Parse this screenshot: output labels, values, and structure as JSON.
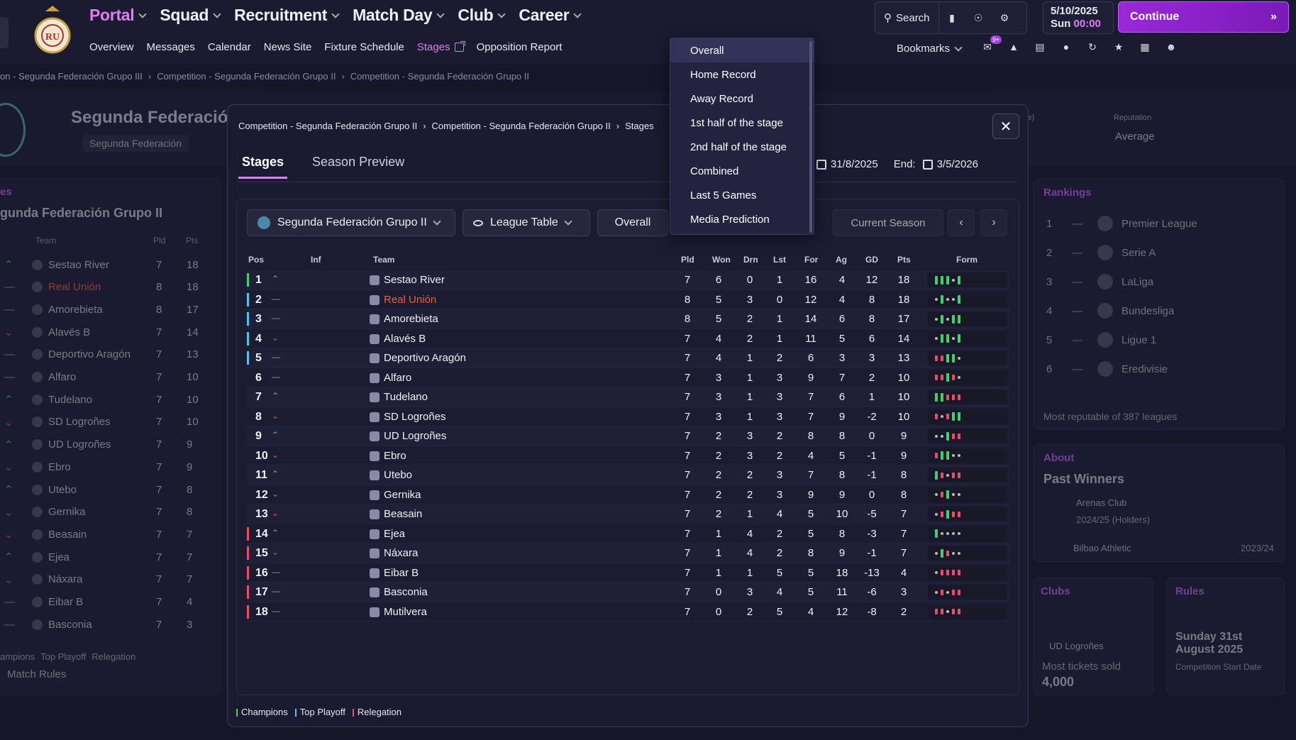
{
  "nav": {
    "main": [
      {
        "label": "Portal",
        "active": true
      },
      {
        "label": "Squad",
        "active": false
      },
      {
        "label": "Recruitment",
        "active": false
      },
      {
        "label": "Match Day",
        "active": false
      },
      {
        "label": "Club",
        "active": false
      },
      {
        "label": "Career",
        "active": false
      }
    ],
    "sub": [
      "Overview",
      "Messages",
      "Calendar",
      "News Site",
      "Fixture Schedule",
      "Stages",
      "Opposition Report"
    ],
    "sub_active": "Stages"
  },
  "toolbar": {
    "search_label": "Search",
    "bookmarks_label": "Bookmarks",
    "badge": "9+"
  },
  "date": {
    "date": "5/10/2025",
    "day": "Sun",
    "time": "00:00"
  },
  "continue_label": "Continue",
  "breadcrumb": [
    "on - Segunda Federación Grupo III",
    "Competition - Segunda Federación Grupo II",
    "Competition - Segunda Federación Grupo II"
  ],
  "background": {
    "comp_title": "Segunda Federación",
    "comp_sub": "Segunda Federación",
    "reputation_label": "Reputation",
    "reputation_value": "Average",
    "paren_text": "je)",
    "left_title": "gunda Federación Grupo II",
    "left_section": "es",
    "left_headers": [
      "Team",
      "Pld",
      "Pts"
    ],
    "left_rows": [
      {
        "team": "Sestao River",
        "pld": "7",
        "pts": "18"
      },
      {
        "team": "Real Unión",
        "pld": "8",
        "pts": "18"
      },
      {
        "team": "Amorebieta",
        "pld": "8",
        "pts": "17"
      },
      {
        "team": "Alavés B",
        "pld": "7",
        "pts": "14"
      },
      {
        "team": "Deportivo Aragón",
        "pld": "7",
        "pts": "13"
      },
      {
        "team": "Alfaro",
        "pld": "7",
        "pts": "10"
      },
      {
        "team": "Tudelano",
        "pld": "7",
        "pts": "10"
      },
      {
        "team": "SD Logroñes",
        "pld": "7",
        "pts": "10"
      },
      {
        "team": "UD Logroñes",
        "pld": "7",
        "pts": "9"
      },
      {
        "team": "Ebro",
        "pld": "7",
        "pts": "9"
      },
      {
        "team": "Utebo",
        "pld": "7",
        "pts": "8"
      },
      {
        "team": "Gernika",
        "pld": "7",
        "pts": "8"
      },
      {
        "team": "Beasain",
        "pld": "7",
        "pts": "7"
      },
      {
        "team": "Ejea",
        "pld": "7",
        "pts": "7"
      },
      {
        "team": "Náxara",
        "pld": "7",
        "pts": "7"
      },
      {
        "team": "Eibar B",
        "pld": "7",
        "pts": "4"
      },
      {
        "team": "Basconia",
        "pld": "7",
        "pts": "3"
      }
    ],
    "left_legend": [
      "ampions",
      "Top Playoff",
      "Relegation"
    ],
    "match_rules": "Match Rules",
    "rankings_title": "Rankings",
    "rankings": [
      {
        "pos": "1",
        "name": "Premier League"
      },
      {
        "pos": "2",
        "name": "Serie A"
      },
      {
        "pos": "3",
        "name": "LaLiga"
      },
      {
        "pos": "4",
        "name": "Bundesliga"
      },
      {
        "pos": "5",
        "name": "Ligue 1"
      },
      {
        "pos": "6",
        "name": "Eredivisie"
      }
    ],
    "rankings_note": "Most reputable of 387 leagues",
    "about_title": "About",
    "past_winners": "Past Winners",
    "winner1_club": "Arenas Club",
    "winner1_season": "2024/25 (Holders)",
    "winner2_club": "Bilbao Athletic",
    "winner2_season": "2023/24",
    "clubs_title": "Clubs",
    "clubs_club": "UD Logroñes",
    "clubs_stat_label": "Most tickets sold",
    "clubs_stat_value": "4,000",
    "rules_title": "Rules",
    "rules_date": "Sunday 31st August 2025",
    "rules_note": "Competition Start Date"
  },
  "modal": {
    "crumb": [
      "Competition - Segunda Federación Grupo II",
      "Competition - Segunda Federación Grupo II",
      "Stages"
    ],
    "tabs": [
      "Stages",
      "Season Preview"
    ],
    "start_date": "31/8/2025",
    "end_label": "End:",
    "end_date": "3/5/2026",
    "competition_select": "Segunda Federación Grupo II",
    "view_select": "League Table",
    "record_select": "Overall",
    "current_season": "Current Season",
    "headers": [
      "Pos",
      "Inf",
      "Team",
      "Pld",
      "Won",
      "Drn",
      "Lst",
      "For",
      "Ag",
      "GD",
      "Pts",
      "Form"
    ],
    "legend": [
      "Champions",
      "Top Playoff",
      "Relegation"
    ],
    "legend_colors": [
      "#3ed36a",
      "#4ac8e8",
      "#f04a6a"
    ]
  },
  "dropdown": {
    "items": [
      "Overall",
      "Home Record",
      "Away Record",
      "1st half of the stage",
      "2nd half of the stage",
      "Combined",
      "Last 5 Games",
      "Media Prediction"
    ],
    "selected": "Overall"
  },
  "table": [
    {
      "pos": "1",
      "move": "up",
      "team": "Sestao River",
      "pld": "7",
      "won": "6",
      "drn": "0",
      "lst": "1",
      "for": "16",
      "ag": "4",
      "gd": "12",
      "pts": "18",
      "zone": "champ",
      "form": "WWWDW"
    },
    {
      "pos": "2",
      "move": "same",
      "team": "Real Unión",
      "pld": "8",
      "won": "5",
      "drn": "3",
      "lst": "0",
      "for": "12",
      "ag": "4",
      "gd": "8",
      "pts": "18",
      "zone": "playoff",
      "form": "DWDDW",
      "highlight": true
    },
    {
      "pos": "3",
      "move": "same",
      "team": "Amorebieta",
      "pld": "8",
      "won": "5",
      "drn": "2",
      "lst": "1",
      "for": "14",
      "ag": "6",
      "gd": "8",
      "pts": "17",
      "zone": "playoff",
      "form": "DWDWW"
    },
    {
      "pos": "4",
      "move": "down",
      "team": "Alavés B",
      "pld": "7",
      "won": "4",
      "drn": "2",
      "lst": "1",
      "for": "11",
      "ag": "5",
      "gd": "6",
      "pts": "14",
      "zone": "playoff",
      "form": "DWWDW"
    },
    {
      "pos": "5",
      "move": "same",
      "team": "Deportivo Aragón",
      "pld": "7",
      "won": "4",
      "drn": "1",
      "lst": "2",
      "for": "6",
      "ag": "3",
      "gd": "3",
      "pts": "13",
      "zone": "playoff",
      "form": "LLWWD"
    },
    {
      "pos": "6",
      "move": "same",
      "team": "Alfaro",
      "pld": "7",
      "won": "3",
      "drn": "1",
      "lst": "3",
      "for": "9",
      "ag": "7",
      "gd": "2",
      "pts": "10",
      "zone": "none",
      "form": "LLWLD"
    },
    {
      "pos": "7",
      "move": "up",
      "team": "Tudelano",
      "pld": "7",
      "won": "3",
      "drn": "1",
      "lst": "3",
      "for": "7",
      "ag": "6",
      "gd": "1",
      "pts": "10",
      "zone": "none",
      "form": "WWLLL"
    },
    {
      "pos": "8",
      "move": "down",
      "team": "SD Logroñes",
      "pld": "7",
      "won": "3",
      "drn": "1",
      "lst": "3",
      "for": "7",
      "ag": "9",
      "gd": "-2",
      "pts": "10",
      "zone": "none",
      "form": "LDLWW"
    },
    {
      "pos": "9",
      "move": "up",
      "team": "UD Logroñes",
      "pld": "7",
      "won": "2",
      "drn": "3",
      "lst": "2",
      "for": "8",
      "ag": "8",
      "gd": "0",
      "pts": "9",
      "zone": "none",
      "form": "DDWLL"
    },
    {
      "pos": "10",
      "move": "down",
      "team": "Ebro",
      "pld": "7",
      "won": "2",
      "drn": "3",
      "lst": "2",
      "for": "4",
      "ag": "5",
      "gd": "-1",
      "pts": "9",
      "zone": "none",
      "form": "LWWDD"
    },
    {
      "pos": "11",
      "move": "up",
      "team": "Utebo",
      "pld": "7",
      "won": "2",
      "drn": "2",
      "lst": "3",
      "for": "7",
      "ag": "8",
      "gd": "-1",
      "pts": "8",
      "zone": "none",
      "form": "WLDLL"
    },
    {
      "pos": "12",
      "move": "down",
      "team": "Gernika",
      "pld": "7",
      "won": "2",
      "drn": "2",
      "lst": "3",
      "for": "9",
      "ag": "9",
      "gd": "0",
      "pts": "8",
      "zone": "none",
      "form": "DLWDD"
    },
    {
      "pos": "13",
      "move": "down",
      "team": "Beasain",
      "pld": "7",
      "won": "2",
      "drn": "1",
      "lst": "4",
      "for": "5",
      "ag": "10",
      "gd": "-5",
      "pts": "7",
      "zone": "none",
      "form": "DLWLL"
    },
    {
      "pos": "14",
      "move": "up",
      "team": "Ejea",
      "pld": "7",
      "won": "1",
      "drn": "4",
      "lst": "2",
      "for": "5",
      "ag": "8",
      "gd": "-3",
      "pts": "7",
      "zone": "releg",
      "form": "WDDDD"
    },
    {
      "pos": "15",
      "move": "down",
      "team": "Náxara",
      "pld": "7",
      "won": "1",
      "drn": "4",
      "lst": "2",
      "for": "8",
      "ag": "9",
      "gd": "-1",
      "pts": "7",
      "zone": "releg",
      "form": "DWLDD"
    },
    {
      "pos": "16",
      "move": "same",
      "team": "Eibar B",
      "pld": "7",
      "won": "1",
      "drn": "1",
      "lst": "5",
      "for": "5",
      "ag": "18",
      "gd": "-13",
      "pts": "4",
      "zone": "releg",
      "form": "DLLLL"
    },
    {
      "pos": "17",
      "move": "same",
      "team": "Basconia",
      "pld": "7",
      "won": "0",
      "drn": "3",
      "lst": "4",
      "for": "5",
      "ag": "11",
      "gd": "-6",
      "pts": "3",
      "zone": "releg",
      "form": "DLDLL"
    },
    {
      "pos": "18",
      "move": "same",
      "team": "Mutilvera",
      "pld": "7",
      "won": "0",
      "drn": "2",
      "lst": "5",
      "for": "4",
      "ag": "12",
      "gd": "-8",
      "pts": "2",
      "zone": "releg",
      "form": "LLDLL"
    }
  ],
  "colors": {
    "accent": "#e07cf8",
    "highlight_team": "#f0603a",
    "win": "#3ed36a",
    "loss": "#f04a6a",
    "playoff": "#4ac8e8"
  }
}
